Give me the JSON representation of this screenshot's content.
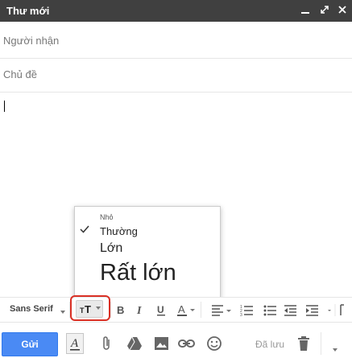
{
  "window": {
    "title": "Thư mới"
  },
  "fields": {
    "to_placeholder": "Người nhận",
    "subject_placeholder": "Chủ đề"
  },
  "size_menu": {
    "items": [
      {
        "label": "Nhỏ",
        "selected": false
      },
      {
        "label": "Thường",
        "selected": true
      },
      {
        "label": "Lớn",
        "selected": false
      },
      {
        "label": "Rất lớn",
        "selected": false
      }
    ]
  },
  "toolbar": {
    "font_family": "Sans Serif"
  },
  "bottom_bar": {
    "send_label": "Gửi",
    "saved_label": "Đã lưu"
  },
  "colors": {
    "titlebar": "#404040",
    "send_button": "#4a8af4",
    "highlight": "#d93025"
  }
}
